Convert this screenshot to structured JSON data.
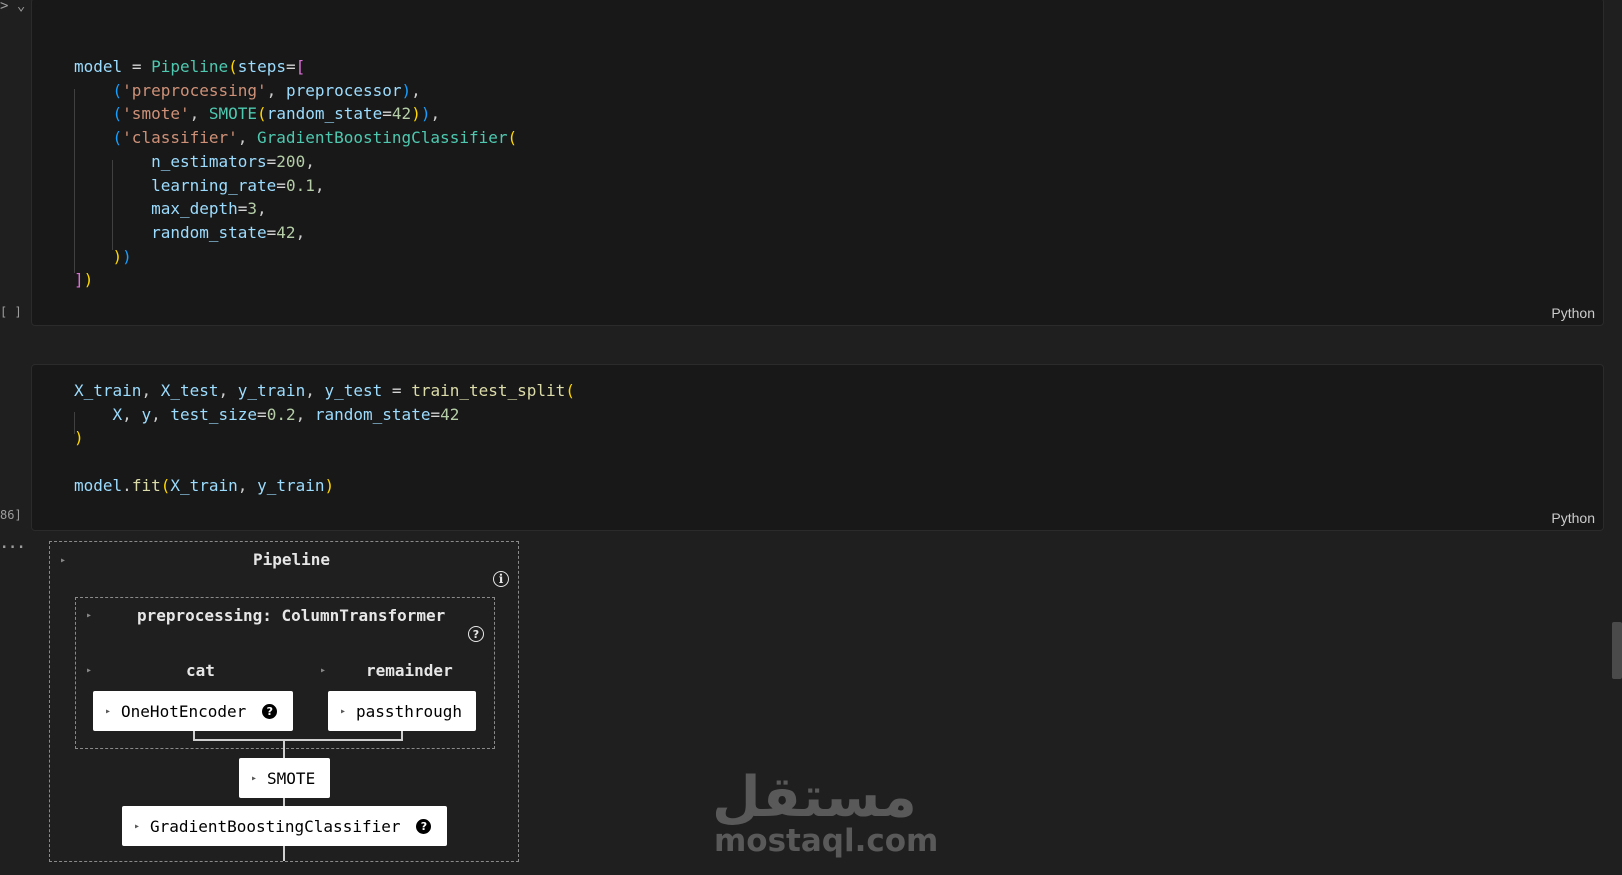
{
  "gutter": {
    "top_chevron": "> ⌄",
    "cell1_exec": "[ ]",
    "cell2_exec": "86]",
    "output_menu": "..."
  },
  "cell1": {
    "language": "Python"
  },
  "cell2": {
    "language": "Python"
  },
  "output": {
    "pipeline_label": "Pipeline",
    "info_icon": "i",
    "preprocessing_label": "preprocessing: ColumnTransformer",
    "help_icon": "?",
    "cat_label": "cat",
    "remainder_label": "remainder",
    "onehot_label": "OneHotEncoder",
    "passthrough_label": "passthrough",
    "smote_label": "SMOTE",
    "gbc_label": "GradientBoostingClassifier"
  },
  "watermark": {
    "arabic": "مستقل",
    "latin": "mostaql.com"
  },
  "colors": {
    "background": "#1f1f1f",
    "cell_bg": "#181818",
    "variable": "#9cdcfe",
    "class": "#4ec9b0",
    "function": "#dcdcaa",
    "string": "#ce9178",
    "number": "#b5cea8",
    "bracket_gold": "#ffd700",
    "bracket_purple": "#da70d6",
    "bracket_blue": "#179fff"
  }
}
